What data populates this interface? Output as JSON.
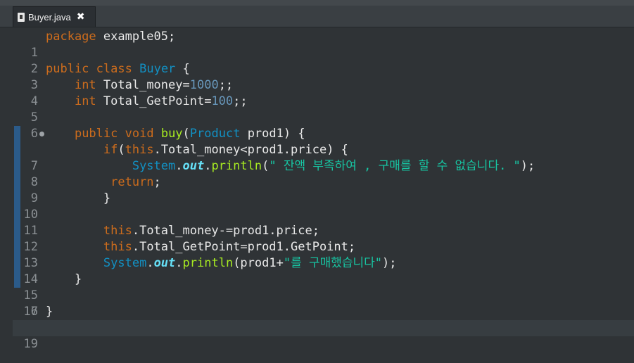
{
  "tab": {
    "label": "Buyer.java",
    "close": "✖"
  },
  "code_lines": [
    {
      "n": "1"
    },
    {
      "n": "2"
    },
    {
      "n": "3"
    },
    {
      "n": "4"
    },
    {
      "n": "5"
    },
    {
      "n": "6"
    },
    {
      "n": "7"
    },
    {
      "n": "8"
    },
    {
      "n": "9"
    },
    {
      "n": "10"
    },
    {
      "n": "11"
    },
    {
      "n": "12"
    },
    {
      "n": "13"
    },
    {
      "n": "14"
    },
    {
      "n": "15"
    },
    {
      "n": "16"
    },
    {
      "n": "17"
    },
    {
      "n": "18"
    },
    {
      "n": "19"
    }
  ],
  "tokens": {
    "l1": [
      "package",
      " example05;"
    ],
    "l3": [
      "public",
      " ",
      "class",
      " ",
      "Buyer",
      " {"
    ],
    "l4": [
      "int",
      " Total_money=",
      "1000",
      ";;"
    ],
    "l5": [
      "int",
      " Total_GetPoint=",
      "100",
      ";;"
    ],
    "l7": [
      "public",
      " ",
      "void",
      " ",
      "buy",
      "(",
      "Product",
      " prod1) {"
    ],
    "l8": [
      "if",
      "(",
      "this",
      ".Total_money<prod1.price) {"
    ],
    "l9": [
      "System",
      ".",
      "out",
      ".",
      "println",
      "(",
      "\" 잔액 부족하여 , 구매를 할 수 없습니다. \"",
      ");"
    ],
    "l10": [
      "return",
      ";"
    ],
    "l11": [
      "}"
    ],
    "l13": [
      "this",
      ".Total_money-=prod1.price;"
    ],
    "l14": [
      "this",
      ".Total_GetPoint=prod1.GetPoint;"
    ],
    "l15": [
      "System",
      ".",
      "out",
      ".",
      "println",
      "(prod1+",
      "\"를 구매했습니다\"",
      ");"
    ],
    "l16": [
      "}"
    ],
    "l18": [
      "}"
    ]
  },
  "colors": {
    "keyword": "#cc6c1d",
    "type": "#1290c3",
    "number": "#6897bb",
    "method": "#a7ec21",
    "string": "#17c6a3",
    "field_static": "#66e1f8",
    "background": "#2f3336"
  },
  "icons": {
    "file": "java-file-icon",
    "fold": "fold-collapse-icon"
  }
}
